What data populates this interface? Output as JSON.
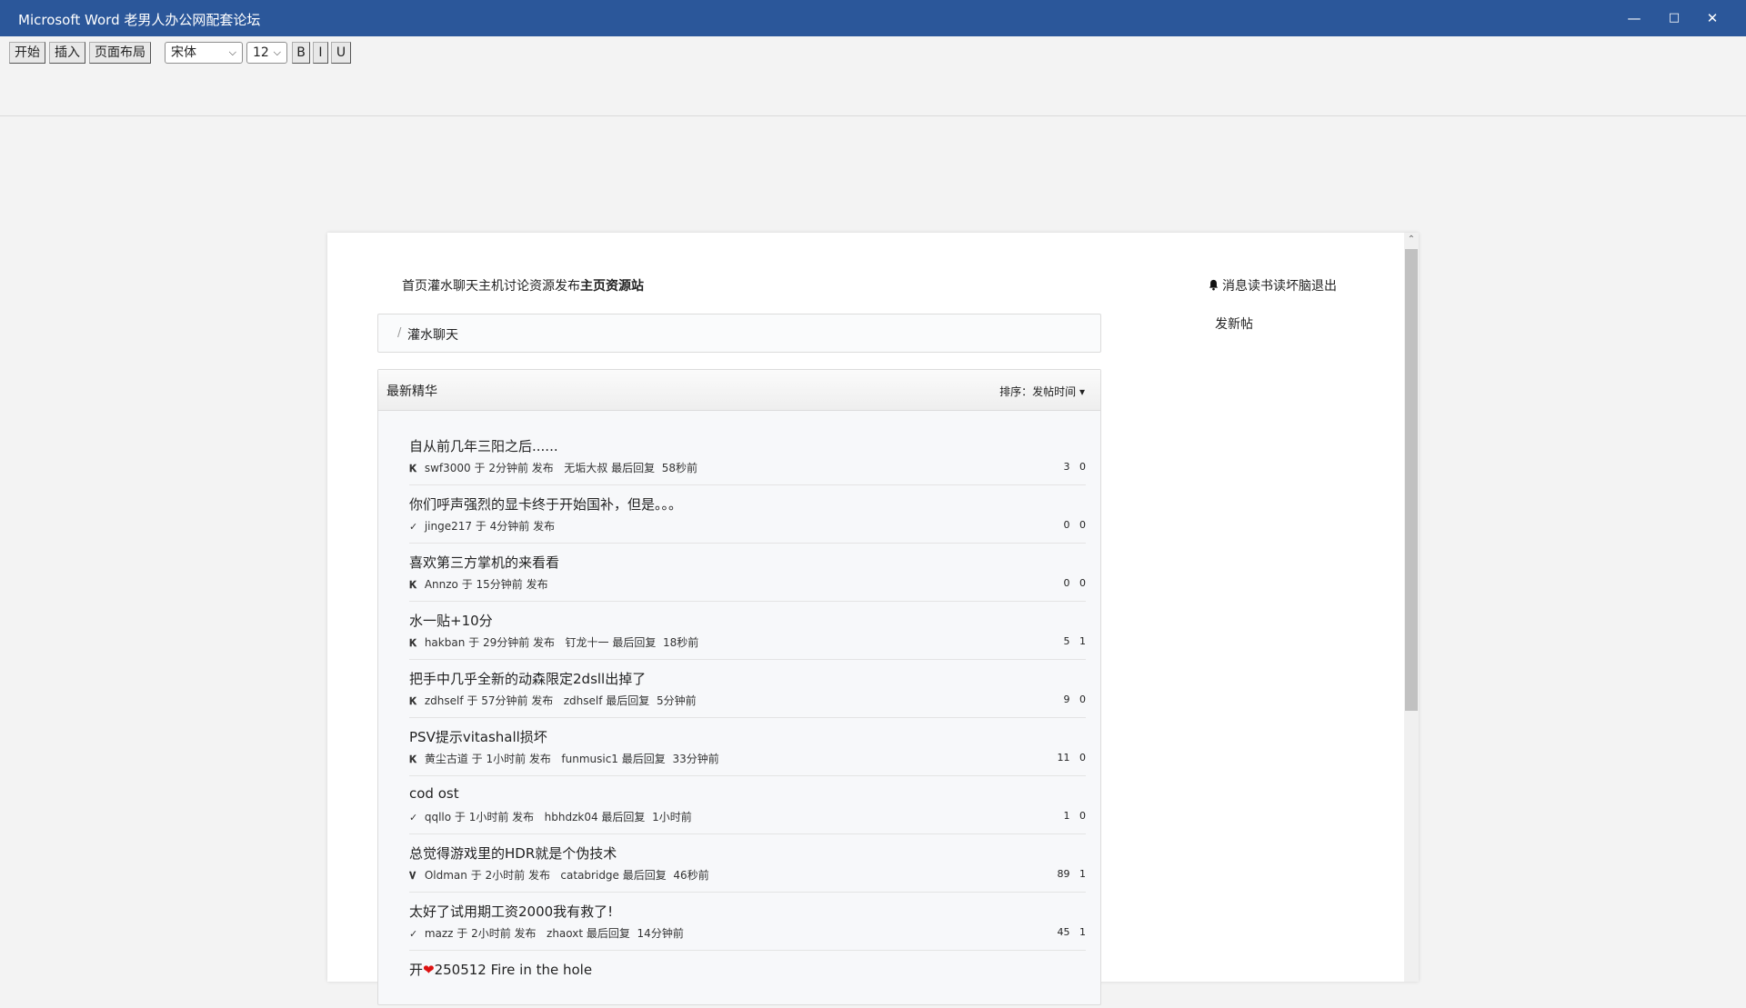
{
  "window": {
    "title": "Microsoft Word 老男人办公网配套论坛",
    "minimize": "—",
    "maximize": "□",
    "close": "✕"
  },
  "ribbon": {
    "tabs": [
      "开始",
      "插入",
      "页面布局"
    ],
    "font": "宋体",
    "size": "12",
    "bold": "B",
    "italic": "I",
    "underline": "U"
  },
  "forum": {
    "nav": {
      "home": "首页",
      "chat": "灌水聊天",
      "host": "主机讨论",
      "resources": "资源发布",
      "main": "主页",
      "res_site": "资源站"
    },
    "user_nav": {
      "bell_icon": "bell-icon",
      "messages": "消息",
      "username": "读书读坏脑",
      "logout": "退出"
    },
    "new_post": "发新帖",
    "breadcrumb": {
      "sep": "/",
      "current": "灌水聊天"
    },
    "list": {
      "header": "最新精华",
      "sort": "排序：发帖时间 ▾",
      "threads": [
        {
          "title": "自从前几年三阳之后......",
          "author": "swf3000",
          "posted": "于 2分钟前 发布",
          "last_user": "无垢大叔",
          "last": "最后回复",
          "last_time": "58秒前",
          "replies": "3",
          "likes": "0"
        },
        {
          "title": "你们呼声强烈的显卡终于开始国补，但是。。。",
          "author": "jinge217",
          "posted": "于 4分钟前 发布",
          "last_user": "",
          "last": "",
          "last_time": "",
          "replies": "0",
          "likes": "0"
        },
        {
          "title": "喜欢第三方掌机的来看看",
          "author": "Annzo",
          "posted": "于 15分钟前 发布",
          "last_user": "",
          "last": "",
          "last_time": "",
          "replies": "0",
          "likes": "0"
        },
        {
          "title": "水一贴+10分",
          "author": "hakban",
          "posted": "于 29分钟前 发布",
          "last_user": "钉龙十一",
          "last": "最后回复",
          "last_time": "18秒前",
          "replies": "5",
          "likes": "1"
        },
        {
          "title": "把手中几乎全新的动森限定2dsll出掉了",
          "author": "zdhself",
          "posted": "于 57分钟前 发布",
          "last_user": "zdhself",
          "last": "最后回复",
          "last_time": "5分钟前",
          "replies": "9",
          "likes": "0"
        },
        {
          "title": "PSV提示vitashall损坏",
          "author": "黄尘古道",
          "posted": "于 1小时前 发布",
          "last_user": "funmusic1",
          "last": "最后回复",
          "last_time": "33分钟前",
          "replies": "11",
          "likes": "0"
        },
        {
          "title": "cod ost",
          "author": "qqllo",
          "posted": "于 1小时前 发布",
          "last_user": "hbhdzk04",
          "last": "最后回复",
          "last_time": "1小时前",
          "replies": "1",
          "likes": "0"
        },
        {
          "title": "总觉得游戏里的HDR就是个伪技术",
          "author": "Oldman",
          "posted": "于 2小时前 发布",
          "last_user": "catabridge",
          "last": "最后回复",
          "last_time": "46秒前",
          "replies": "89",
          "likes": "1"
        },
        {
          "title": "太好了试用期工资2000我有救了!",
          "author": "mazz",
          "posted": "于 2小时前 发布",
          "last_user": "zhaoxt",
          "last": "最后回复",
          "last_time": "14分钟前",
          "replies": "45",
          "likes": "1"
        }
      ],
      "last_row": {
        "prefix": "开",
        "suffix": "250512 Fire in the hole"
      }
    }
  },
  "icons": {
    "row_icons": [
      "𝐊",
      "✓",
      "𝐊",
      "𝐊",
      "𝐊",
      "𝐊",
      "✓",
      "𝐕",
      "✓"
    ]
  }
}
